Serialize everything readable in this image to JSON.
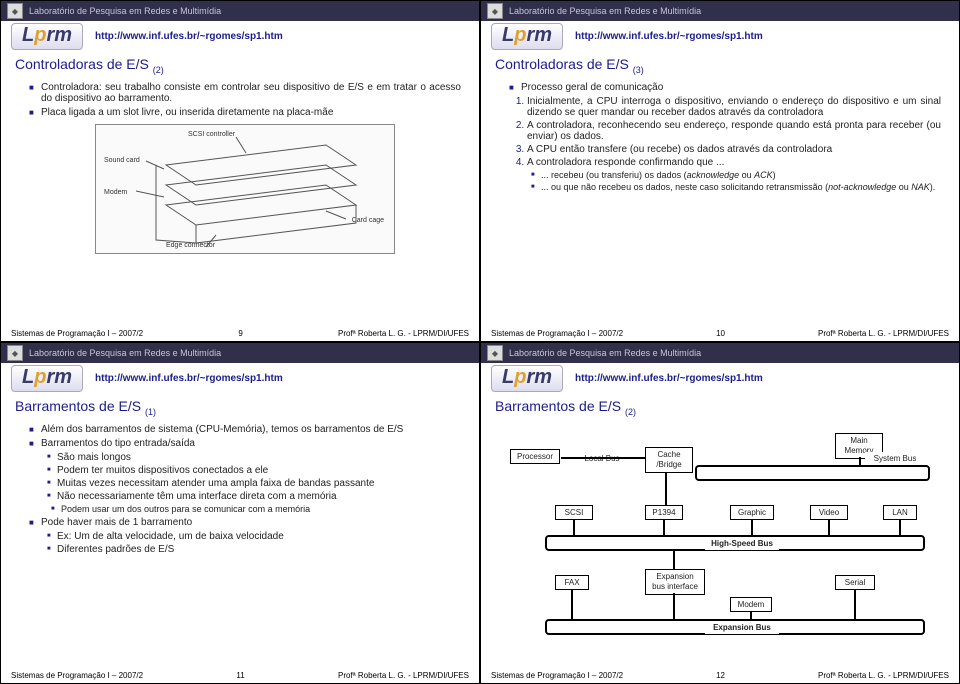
{
  "lab": "Laboratório de Pesquisa em Redes e Multimídia",
  "logo_l": "L",
  "logo_p": "p",
  "logo_rm": "rm",
  "url": "http://www.inf.ufes.br/~rgomes/sp1.htm",
  "footer_left": "Sistemas de Programação I – 2007/2",
  "footer_right": "Profª Roberta L. G. - LPRM/DI/UFES",
  "slides": [
    {
      "num": "9",
      "title": "Controladoras de E/S ",
      "title_sub": "(2)",
      "bullets": [
        "Controladora: seu trabalho consiste em controlar seu dispositivo de E/S e em tratar o acesso do dispositivo ao barramento.",
        "Placa ligada a um slot livre, ou inserida diretamente na placa-mãe"
      ],
      "diag": {
        "scsi": "SCSI controller",
        "sound": "Sound card",
        "modem": "Modem",
        "cage": "Card cage",
        "edge": "Edge connector"
      }
    },
    {
      "num": "10",
      "title": "Controladoras de E/S ",
      "title_sub": "(3)",
      "bullets": [
        "Processo geral de comunicação"
      ],
      "numbered": [
        "Inicialmente, a CPU interroga o dispositivo, enviando o endereço do dispositivo e um sinal dizendo se quer mandar ou receber dados através da controladora",
        "A controladora, reconhecendo seu endereço, responde quando está pronta para receber (ou enviar) os dados.",
        "A CPU então transfere (ou recebe) os dados através da controladora",
        "A controladora responde confirmando que ..."
      ],
      "sub": [
        "... recebeu (ou transferiu) os dados (acknowledge ou ACK)",
        "... ou que não recebeu os dados, neste caso solicitando retransmissão (not-acknowledge ou NAK)."
      ]
    },
    {
      "num": "11",
      "title": "Barramentos de E/S ",
      "title_sub": "(1)",
      "bullets": [
        "Além dos barramentos de sistema (CPU-Memória), temos os barramentos de E/S",
        "Barramentos do tipo entrada/saída"
      ],
      "sub2": [
        "São mais longos",
        "Podem ter muitos dispositivos conectados a ele",
        "Muitas vezes necessitam atender uma ampla faixa de bandas passante",
        "Não necessariamente têm uma interface direta com a memória"
      ],
      "sub3": [
        "Podem usar um dos outros para se comunicar com a memória"
      ],
      "bullets2": [
        "Pode haver mais de 1 barramento"
      ],
      "sub4": [
        "Ex: Um de alta velocidade, um de baixa velocidade",
        "Diferentes padrões de E/S"
      ]
    },
    {
      "num": "12",
      "title": "Barramentos de E/S ",
      "title_sub": "(2)",
      "bus": {
        "proc": "Processor",
        "local": "Local Bus",
        "cache": "Cache /Bridge",
        "mem": "Main Memory",
        "sys": "System Bus",
        "scsi": "SCSI",
        "p1394": "P1394",
        "graphic": "Graphic",
        "video": "Video",
        "lan": "LAN",
        "hsbus": "High-Speed Bus",
        "fax": "FAX",
        "expif": "Expansion bus interface",
        "modem": "Modem",
        "serial": "Serial",
        "expbus": "Expansion Bus"
      }
    }
  ]
}
